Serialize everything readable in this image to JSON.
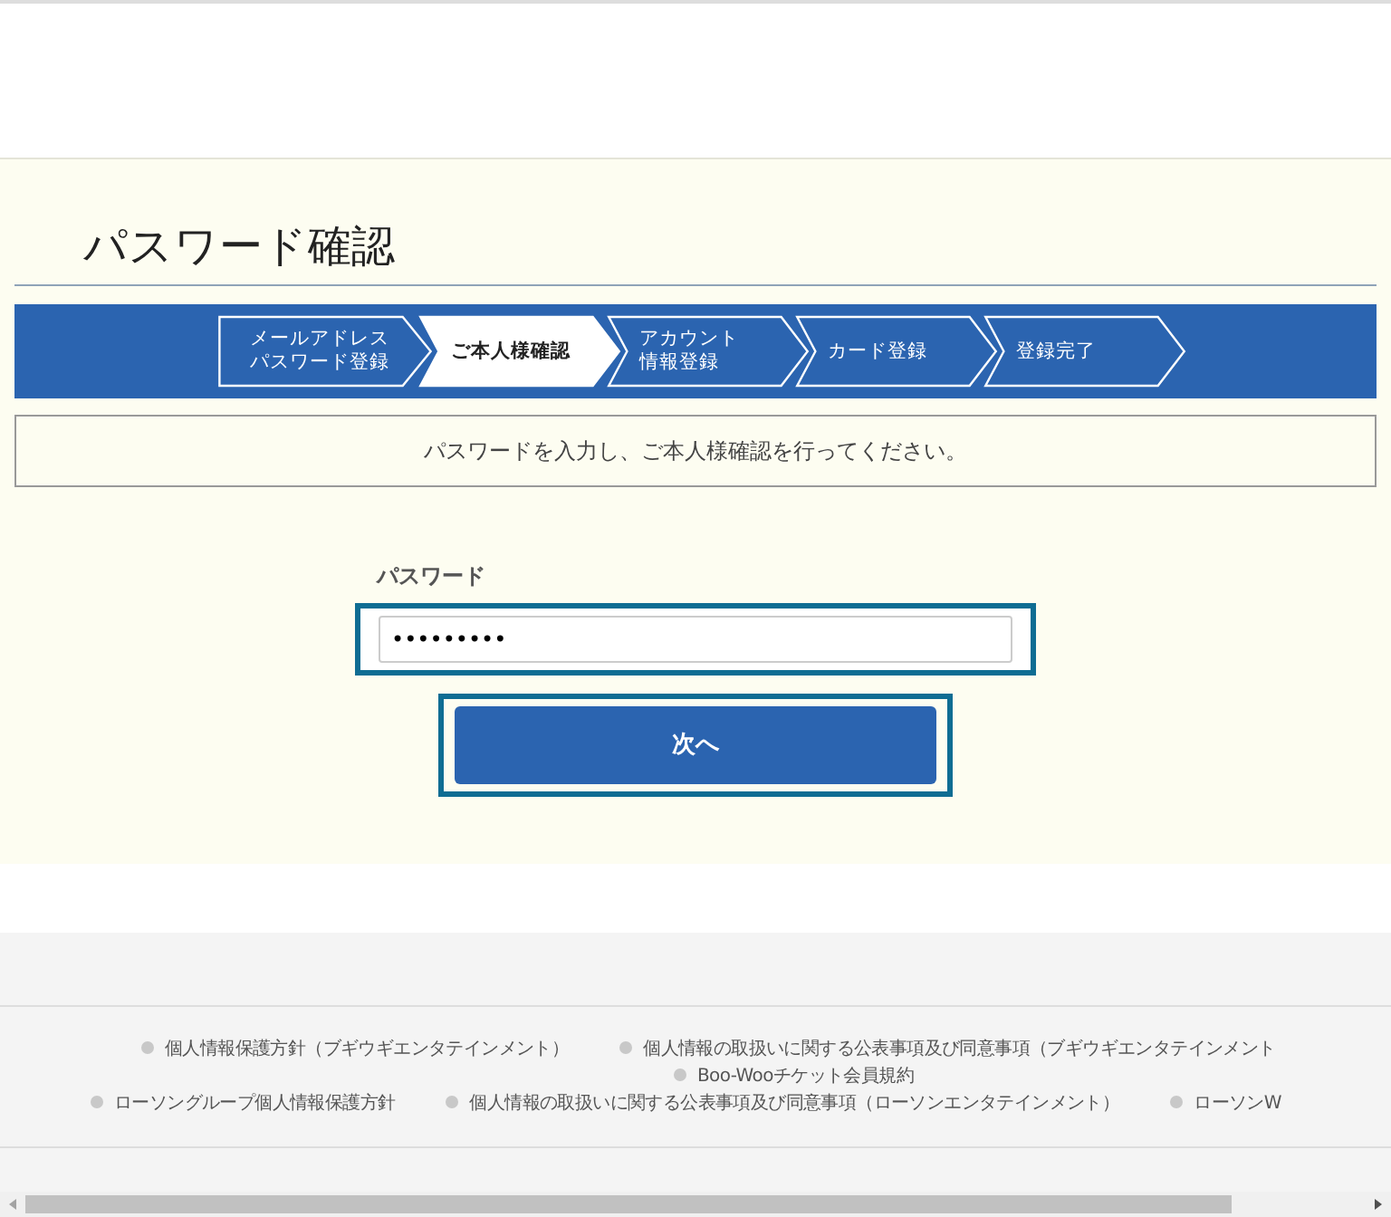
{
  "page_title": "パスワード確認",
  "steps": [
    {
      "lines": [
        "メールアドレス",
        "パスワード登録"
      ],
      "selected": false
    },
    {
      "lines": [
        "ご本人様確認"
      ],
      "selected": true
    },
    {
      "lines": [
        "アカウント",
        "情報登録"
      ],
      "selected": false
    },
    {
      "lines": [
        "カード登録"
      ],
      "selected": false
    },
    {
      "lines": [
        "登録完了"
      ],
      "selected": false
    }
  ],
  "message": "パスワードを入力し、ご本人様確認を行ってください。",
  "password_field": {
    "label": "パスワード",
    "value": "•••••••••"
  },
  "next_button": "次へ",
  "footer_links": [
    [
      "個人情報保護方針（ブギウギエンタテインメント）",
      "個人情報の取扱いに関する公表事項及び同意事項（ブギウギエンタテインメント"
    ],
    [
      "Boo-Wooチケット会員規約"
    ],
    [
      "ローソングループ個人情報保護方針",
      "個人情報の取扱いに関する公表事項及び同意事項（ローソンエンタテインメント）",
      "ローソンW"
    ]
  ]
}
